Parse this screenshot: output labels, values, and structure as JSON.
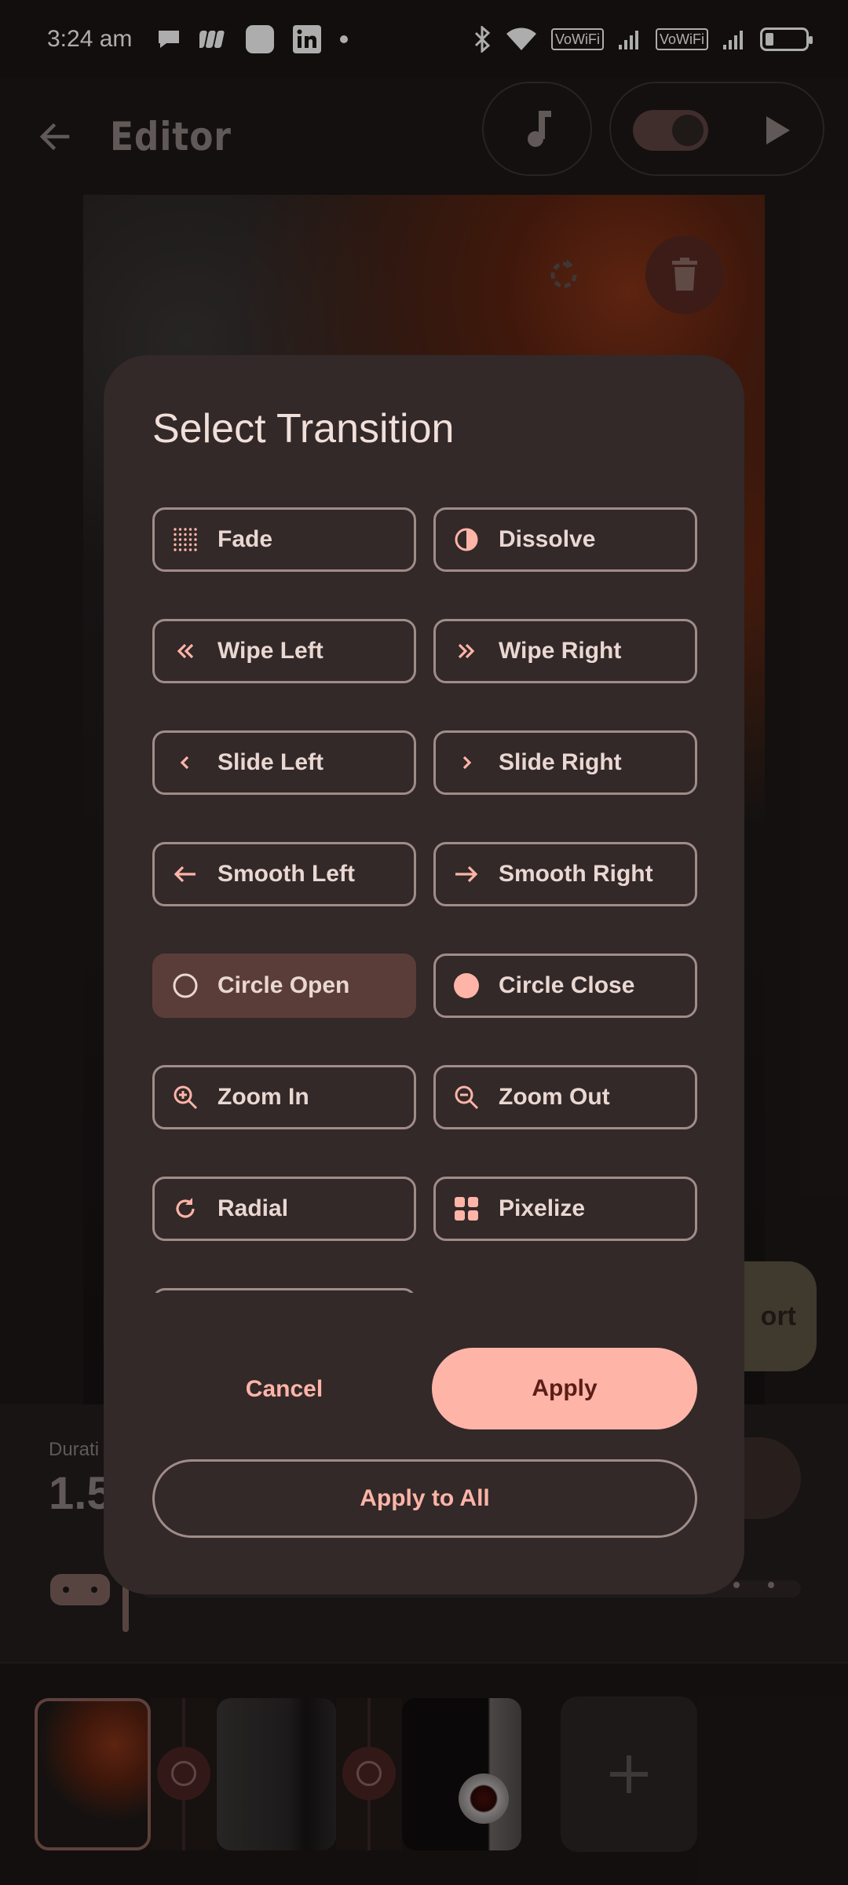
{
  "status_bar": {
    "time": "3:24 am",
    "network_label_1": "VoWiFi",
    "network_label_2": "VoWiFi"
  },
  "app_bar": {
    "title": "Editor"
  },
  "editor": {
    "export_label": "ort",
    "duration_label": "Durati",
    "duration_value": "1.5"
  },
  "dialog": {
    "title": "Select Transition",
    "options": [
      {
        "label": "Fade",
        "icon": "dots-grid-icon",
        "selected": false
      },
      {
        "label": "Dissolve",
        "icon": "half-circle-icon",
        "selected": false
      },
      {
        "label": "Wipe Left",
        "icon": "double-chevron-left-icon",
        "selected": false
      },
      {
        "label": "Wipe Right",
        "icon": "double-chevron-right-icon",
        "selected": false
      },
      {
        "label": "Slide Left",
        "icon": "chevron-left-icon",
        "selected": false
      },
      {
        "label": "Slide Right",
        "icon": "chevron-right-icon",
        "selected": false
      },
      {
        "label": "Smooth Left",
        "icon": "arrow-left-icon",
        "selected": false
      },
      {
        "label": "Smooth Right",
        "icon": "arrow-right-icon",
        "selected": false
      },
      {
        "label": "Circle Open",
        "icon": "circle-outline-icon",
        "selected": true
      },
      {
        "label": "Circle Close",
        "icon": "circle-filled-icon",
        "selected": false
      },
      {
        "label": "Zoom In",
        "icon": "zoom-in-icon",
        "selected": false
      },
      {
        "label": "Zoom Out",
        "icon": "zoom-out-icon",
        "selected": false
      },
      {
        "label": "Radial",
        "icon": "refresh-icon",
        "selected": false
      },
      {
        "label": "Pixelize",
        "icon": "grid-squares-icon",
        "selected": false
      }
    ],
    "cancel_label": "Cancel",
    "apply_label": "Apply",
    "apply_all_label": "Apply to All"
  },
  "colors": {
    "accent": "#ffb4a8",
    "dialog_bg": "#322928",
    "selected_bg": "#5a3d39",
    "outline": "#a08c88"
  }
}
